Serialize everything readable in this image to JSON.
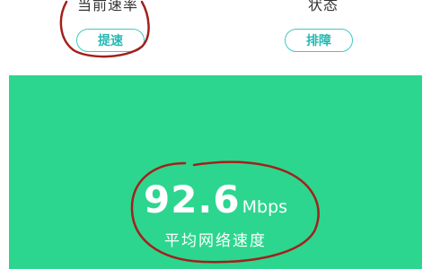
{
  "top": {
    "left_stat": {
      "label": "当前速率",
      "button_label": "提速"
    },
    "right_stat": {
      "label": "状态",
      "button_label": "排障"
    }
  },
  "speed_panel": {
    "value": "92.6",
    "unit": "Mbps",
    "caption": "平均网络速度"
  },
  "colors": {
    "panel_green": "#2cd68f",
    "button_teal": "#3ec9c6",
    "annotation_red": "#a3201c"
  },
  "icons": []
}
